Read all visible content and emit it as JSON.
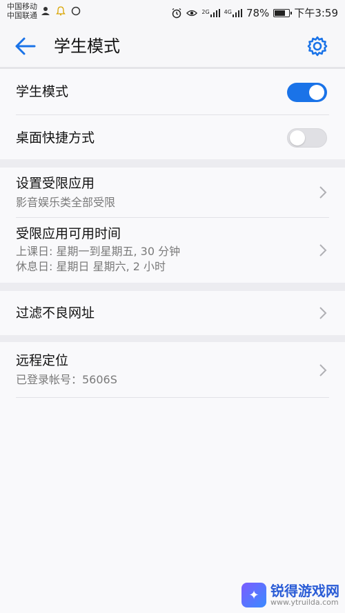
{
  "status_bar": {
    "carrier_1": "中国移动",
    "carrier_2": "中国联通",
    "network_2g": "2G",
    "network_4g": "4G",
    "battery_percent": "78%",
    "battery_level": 0.78,
    "time": "下午3:59"
  },
  "header": {
    "title": "学生模式"
  },
  "toggles": {
    "student_mode": {
      "label": "学生模式",
      "on": true
    },
    "desktop_shortcut": {
      "label": "桌面快捷方式",
      "on": false
    }
  },
  "restrictions": {
    "restricted_apps": {
      "title": "设置受限应用",
      "subtitle": "影音娱乐类全部受限"
    },
    "available_time": {
      "title": "受限应用可用时间",
      "line1": "上课日: 星期一到星期五, 30 分钟",
      "line2": "休息日: 星期日 星期六, 2 小时"
    }
  },
  "filter": {
    "title": "过滤不良网址"
  },
  "location": {
    "title": "远程定位",
    "subtitle": "已登录帐号：5606S"
  },
  "watermark": {
    "name": "锐得游戏网",
    "url": "www.ytruilda.com"
  },
  "colors": {
    "accent": "#1a73e8",
    "toggle_off": "#e0e0e4"
  }
}
